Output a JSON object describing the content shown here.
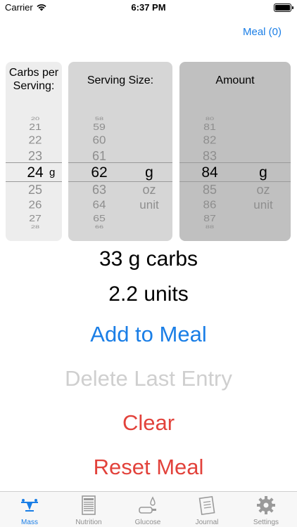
{
  "status_bar": {
    "carrier": "Carrier",
    "time": "6:37 PM"
  },
  "header": {
    "meal_link": "Meal (0)"
  },
  "pickers": {
    "carbs": {
      "title": "Carbs per Serving:",
      "values": [
        "20",
        "21",
        "22",
        "23",
        "24",
        "25",
        "26",
        "27",
        "28"
      ],
      "selected": "24",
      "unit": "g"
    },
    "serving": {
      "title": "Serving Size:",
      "values": [
        "58",
        "59",
        "60",
        "61",
        "62",
        "63",
        "64",
        "65",
        "66"
      ],
      "selected": "62",
      "units": [
        "g",
        "oz",
        "unit"
      ],
      "selected_unit": "g"
    },
    "amount": {
      "title": "Amount",
      "values": [
        "80",
        "81",
        "82",
        "83",
        "84",
        "85",
        "86",
        "87",
        "88"
      ],
      "selected": "84",
      "units": [
        "g",
        "oz",
        "unit"
      ],
      "selected_unit": "g"
    }
  },
  "results": {
    "carbs": "33 g carbs",
    "units": "2.2 units"
  },
  "actions": {
    "add": "Add to Meal",
    "delete_last": "Delete Last Entry",
    "clear": "Clear",
    "reset": "Reset Meal"
  },
  "tabs": [
    {
      "label": "Mass",
      "icon": "scale-icon",
      "active": true
    },
    {
      "label": "Nutrition",
      "icon": "nutrition-label-icon",
      "active": false
    },
    {
      "label": "Glucose",
      "icon": "glucose-meter-icon",
      "active": false
    },
    {
      "label": "Journal",
      "icon": "journal-icon",
      "active": false
    },
    {
      "label": "Settings",
      "icon": "gear-icon",
      "active": false
    }
  ],
  "colors": {
    "accent": "#1a7ee6",
    "destructive": "#e2423b",
    "disabled": "#cfcfcf",
    "carbs_panel": "#ededed",
    "serving_panel": "#d6d6d6",
    "amount_panel": "#c0c0c0"
  }
}
